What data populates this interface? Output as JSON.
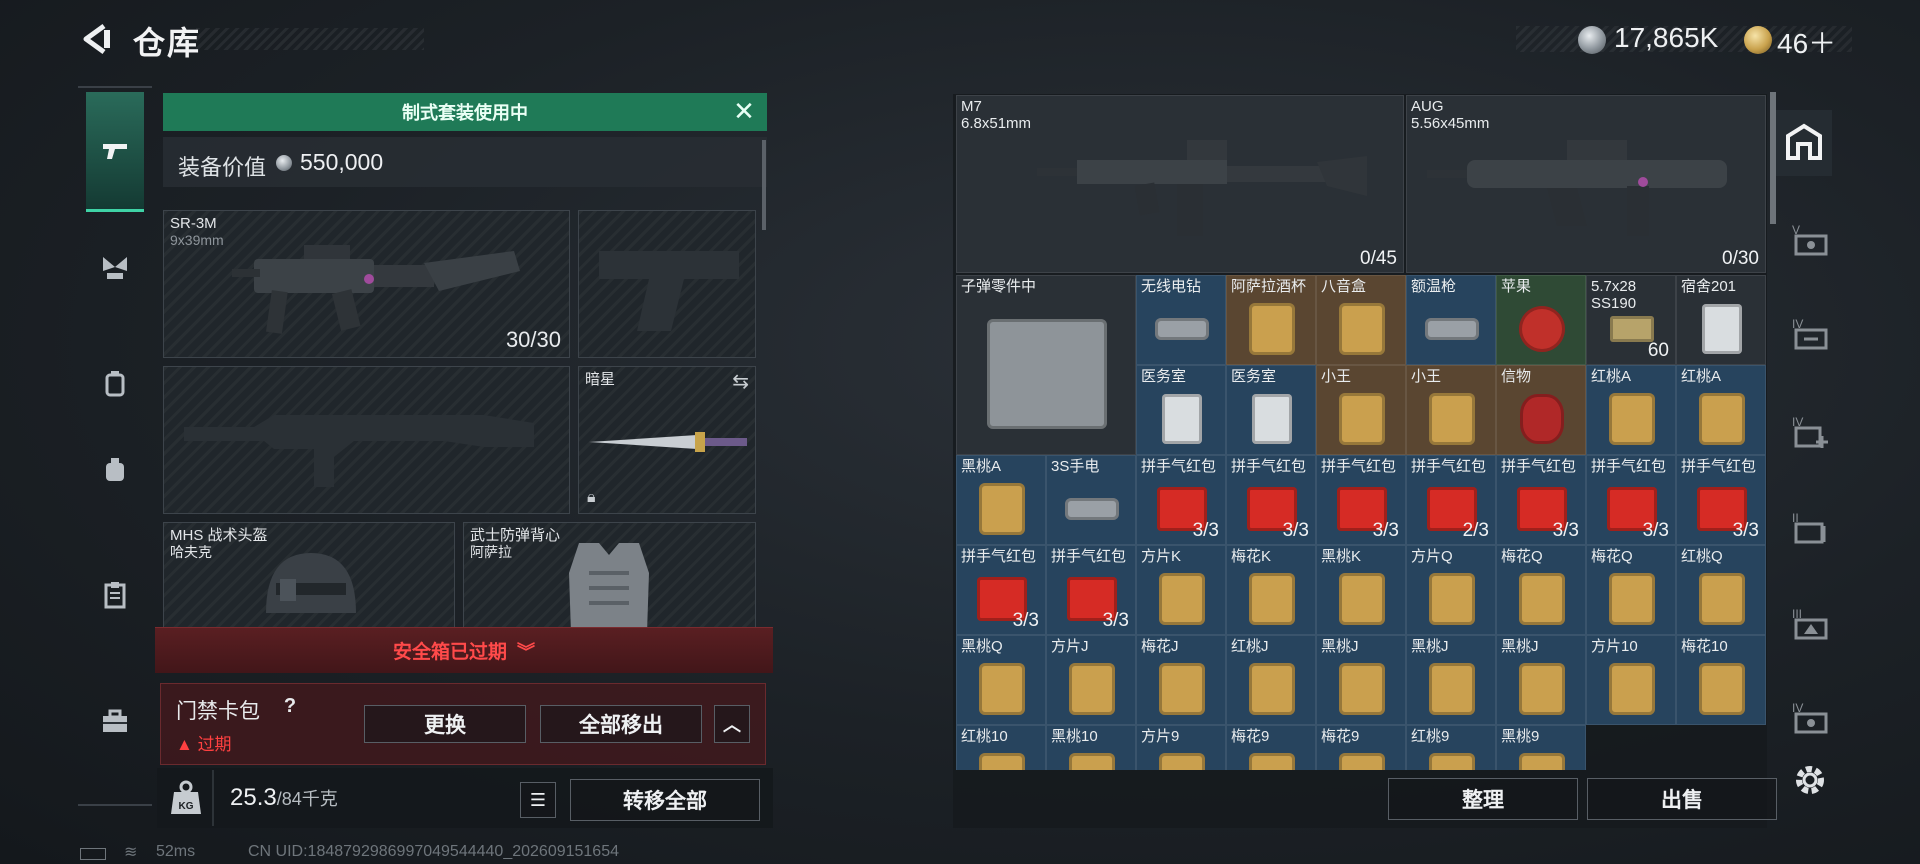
{
  "header": {
    "title": "仓库",
    "coin_amount": "17,865K",
    "gold_amount": "46＋"
  },
  "left_nav": {
    "items": [
      "pistol-icon",
      "butterfly-icon",
      "backpack-icon",
      "pack-icon",
      "clipboard-icon",
      "toolbox-icon"
    ]
  },
  "loadout": {
    "banner": "制式套装使用中",
    "value_label": "装备价值",
    "value": "550,000",
    "slots": {
      "primary": {
        "name": "SR-3M",
        "sub": "9x39mm",
        "count": "30/30"
      },
      "knife": {
        "name": "暗星"
      },
      "helmet": {
        "name": "MHS 战术头盔",
        "sub": "哈夫克"
      },
      "vest": {
        "name": "武士防弹背心",
        "sub": "阿萨拉"
      }
    },
    "safe_box": "安全箱已过期",
    "card_pack": {
      "label": "门禁卡包",
      "help": "?",
      "expired": "过期",
      "replace": "更换",
      "move_all": "全部移出"
    },
    "weight": {
      "current": "25.3",
      "max": "/84千克"
    },
    "transfer_all": "转移全部"
  },
  "status": {
    "ping": "52ms",
    "uid": "CN UID:1848792986997049544440_202609151654"
  },
  "storage": {
    "weapons": [
      {
        "name": "M7",
        "sub": "6.8x51mm",
        "count": "0/45"
      },
      {
        "name": "AUG",
        "sub": "5.56x45mm",
        "count": "0/30"
      }
    ],
    "items": [
      {
        "name": "子弹零件中",
        "bg": "gray"
      },
      {
        "name": "无线电钻",
        "bg": "blue"
      },
      {
        "name": "阿萨拉酒杯",
        "bg": "gold"
      },
      {
        "name": "八音盒",
        "bg": "gold"
      },
      {
        "name": "额温枪",
        "bg": "blue"
      },
      {
        "name": "苹果",
        "bg": "green"
      },
      {
        "name": "5.7x28",
        "sub": "SS190",
        "count": "60",
        "bg": "gray"
      },
      {
        "name": "宿舍201",
        "bg": "gray"
      },
      {
        "name": "医务室",
        "bg": "blue"
      },
      {
        "name": "医务室",
        "bg": "blue"
      },
      {
        "name": "小王",
        "bg": "gold"
      },
      {
        "name": "小王",
        "bg": "gold"
      },
      {
        "name": "信物",
        "bg": "gold"
      },
      {
        "name": "红桃A",
        "bg": "blue"
      },
      {
        "name": "红桃A",
        "bg": "blue"
      },
      {
        "name": "黑桃A",
        "bg": "blue"
      },
      {
        "name": "3S手电",
        "bg": "blue"
      },
      {
        "name": "拼手气红包",
        "count": "3/3",
        "bg": "blue"
      },
      {
        "name": "拼手气红包",
        "count": "3/3",
        "bg": "blue"
      },
      {
        "name": "拼手气红包",
        "count": "3/3",
        "bg": "blue"
      },
      {
        "name": "拼手气红包",
        "count": "2/3",
        "bg": "blue"
      },
      {
        "name": "拼手气红包",
        "count": "3/3",
        "bg": "blue"
      },
      {
        "name": "拼手气红包",
        "count": "3/3",
        "bg": "blue"
      },
      {
        "name": "拼手气红包",
        "count": "3/3",
        "bg": "blue"
      },
      {
        "name": "拼手气红包",
        "count": "3/3",
        "bg": "blue"
      },
      {
        "name": "拼手气红包",
        "count": "3/3",
        "bg": "blue"
      },
      {
        "name": "方片K",
        "bg": "blue"
      },
      {
        "name": "梅花K",
        "bg": "blue"
      },
      {
        "name": "黑桃K",
        "bg": "blue"
      },
      {
        "name": "方片Q",
        "bg": "blue"
      },
      {
        "name": "梅花Q",
        "bg": "blue"
      },
      {
        "name": "梅花Q",
        "bg": "blue"
      },
      {
        "name": "红桃Q",
        "bg": "blue"
      },
      {
        "name": "黑桃Q",
        "bg": "blue"
      },
      {
        "name": "方片J",
        "bg": "blue"
      },
      {
        "name": "梅花J",
        "bg": "blue"
      },
      {
        "name": "红桃J",
        "bg": "blue"
      },
      {
        "name": "黑桃J",
        "bg": "blue"
      },
      {
        "name": "黑桃J",
        "bg": "blue"
      },
      {
        "name": "黑桃J",
        "bg": "blue"
      },
      {
        "name": "方片10",
        "bg": "blue"
      },
      {
        "name": "梅花10",
        "bg": "blue"
      },
      {
        "name": "红桃10",
        "bg": "blue"
      },
      {
        "name": "黑桃10",
        "bg": "blue"
      },
      {
        "name": "方片9",
        "bg": "blue"
      },
      {
        "name": "梅花9",
        "bg": "blue"
      },
      {
        "name": "梅花9",
        "bg": "blue"
      },
      {
        "name": "红桃9",
        "bg": "blue"
      },
      {
        "name": "黑桃9",
        "bg": "blue"
      }
    ],
    "sort": "整理",
    "sell": "出售"
  },
  "right_nav": {
    "items": [
      "safehouse-icon",
      "vault-v-icon",
      "vault-iv-icon",
      "vault-iv-plus-icon",
      "vault-ii-icon",
      "vault-iii-icon",
      "vault-iv-b-icon",
      "settings-icon"
    ]
  },
  "colors": {
    "accent_green": "#1f7a57",
    "expired_red": "#ff4a4a",
    "cell_blue": "#27445e",
    "cell_gold": "#5a4631"
  }
}
